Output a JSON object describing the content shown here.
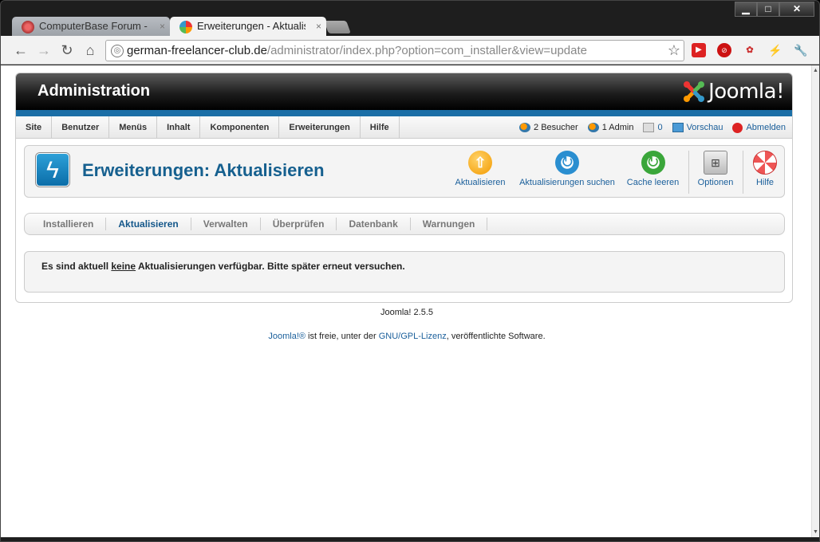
{
  "window": {
    "minimize": "▁",
    "maximize": "□",
    "close": "✕"
  },
  "tabs": [
    {
      "title": "ComputerBase Forum - Ne",
      "close": "×"
    },
    {
      "title": "Erweiterungen - Aktualisier",
      "close": "×"
    }
  ],
  "omnibox": {
    "domain": "german-freelancer-club.de",
    "path": "/administrator/index.php?option=com_installer&view=update"
  },
  "admin": {
    "title": "Administration",
    "logo_text": "Joomla!",
    "menu": [
      "Site",
      "Benutzer",
      "Menüs",
      "Inhalt",
      "Komponenten",
      "Erweiterungen",
      "Hilfe"
    ],
    "status": {
      "visitors": "2 Besucher",
      "admins": "1 Admin",
      "messages": "0",
      "preview": "Vorschau",
      "logout": "Abmelden"
    },
    "page_title": "Erweiterungen: Aktualisieren",
    "toolbar": {
      "update": "Aktualisieren",
      "find_updates": "Aktualisierungen suchen",
      "purge_cache": "Cache leeren",
      "options": "Optionen",
      "help": "Hilfe"
    },
    "subtabs": [
      "Installieren",
      "Aktualisieren",
      "Verwalten",
      "Überprüfen",
      "Datenbank",
      "Warnungen"
    ],
    "message": {
      "pre": "Es sind aktuell ",
      "em": "keine",
      "post": " Aktualisierungen verfügbar. Bitte später erneut versuchen."
    },
    "version": "Joomla! 2.5.5",
    "footer": {
      "link1": "Joomla!®",
      "mid": " ist freie, unter der ",
      "link2": "GNU/GPL-Lizenz",
      "end": ", veröffentlichte Software."
    }
  },
  "colors": {
    "accent": "#1b6fa7",
    "title": "#16608f"
  }
}
